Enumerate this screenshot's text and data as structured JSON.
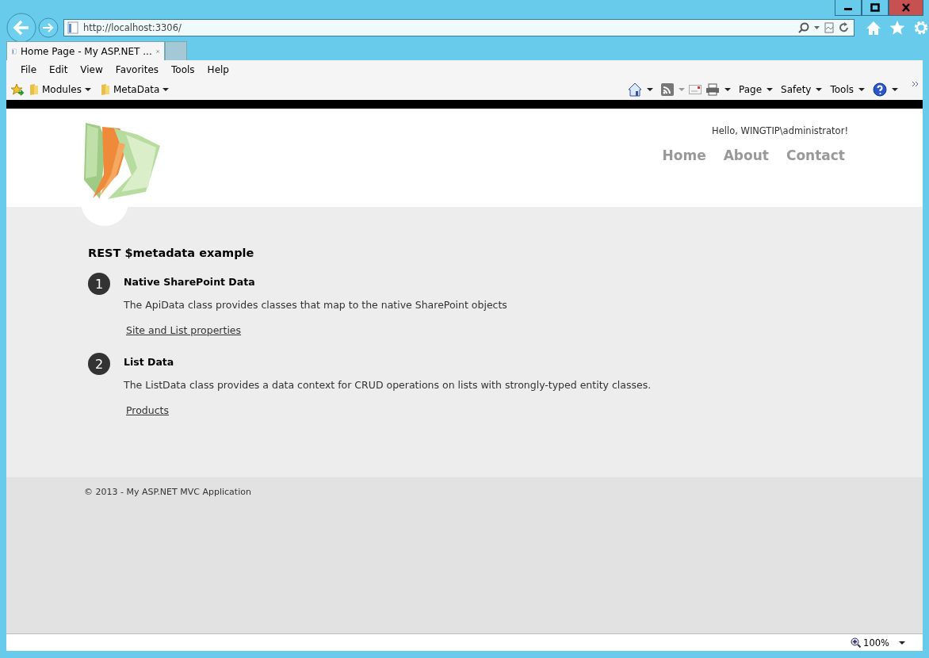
{
  "address_bar": {
    "url": "http://localhost:3306/"
  },
  "tabs": [
    {
      "label": "Home Page - My ASP.NET ...",
      "selected": true
    }
  ],
  "menu_bar": [
    "File",
    "Edit",
    "View",
    "Favorites",
    "Tools",
    "Help"
  ],
  "favorites_bar": [
    "Modules",
    "MetaData"
  ],
  "command_bar": [
    "Page",
    "Safety",
    "Tools"
  ],
  "site": {
    "greeting": "Hello, WINGTIP\\administrator!",
    "nav": [
      "Home",
      "About",
      "Contact"
    ],
    "heading": "REST $metadata example",
    "sections": [
      {
        "number": "1",
        "title": "Native SharePoint Data",
        "description": "The ApiData class provides classes that map to the native SharePoint objects",
        "link": "Site and List properties"
      },
      {
        "number": "2",
        "title": "List Data",
        "description": "The ListData class provides a data context for CRUD operations on lists with strongly-typed entity classes.",
        "link": "Products"
      }
    ],
    "footer": "© 2013 - My ASP.NET MVC Application"
  },
  "status_bar": {
    "zoom": "100%"
  }
}
